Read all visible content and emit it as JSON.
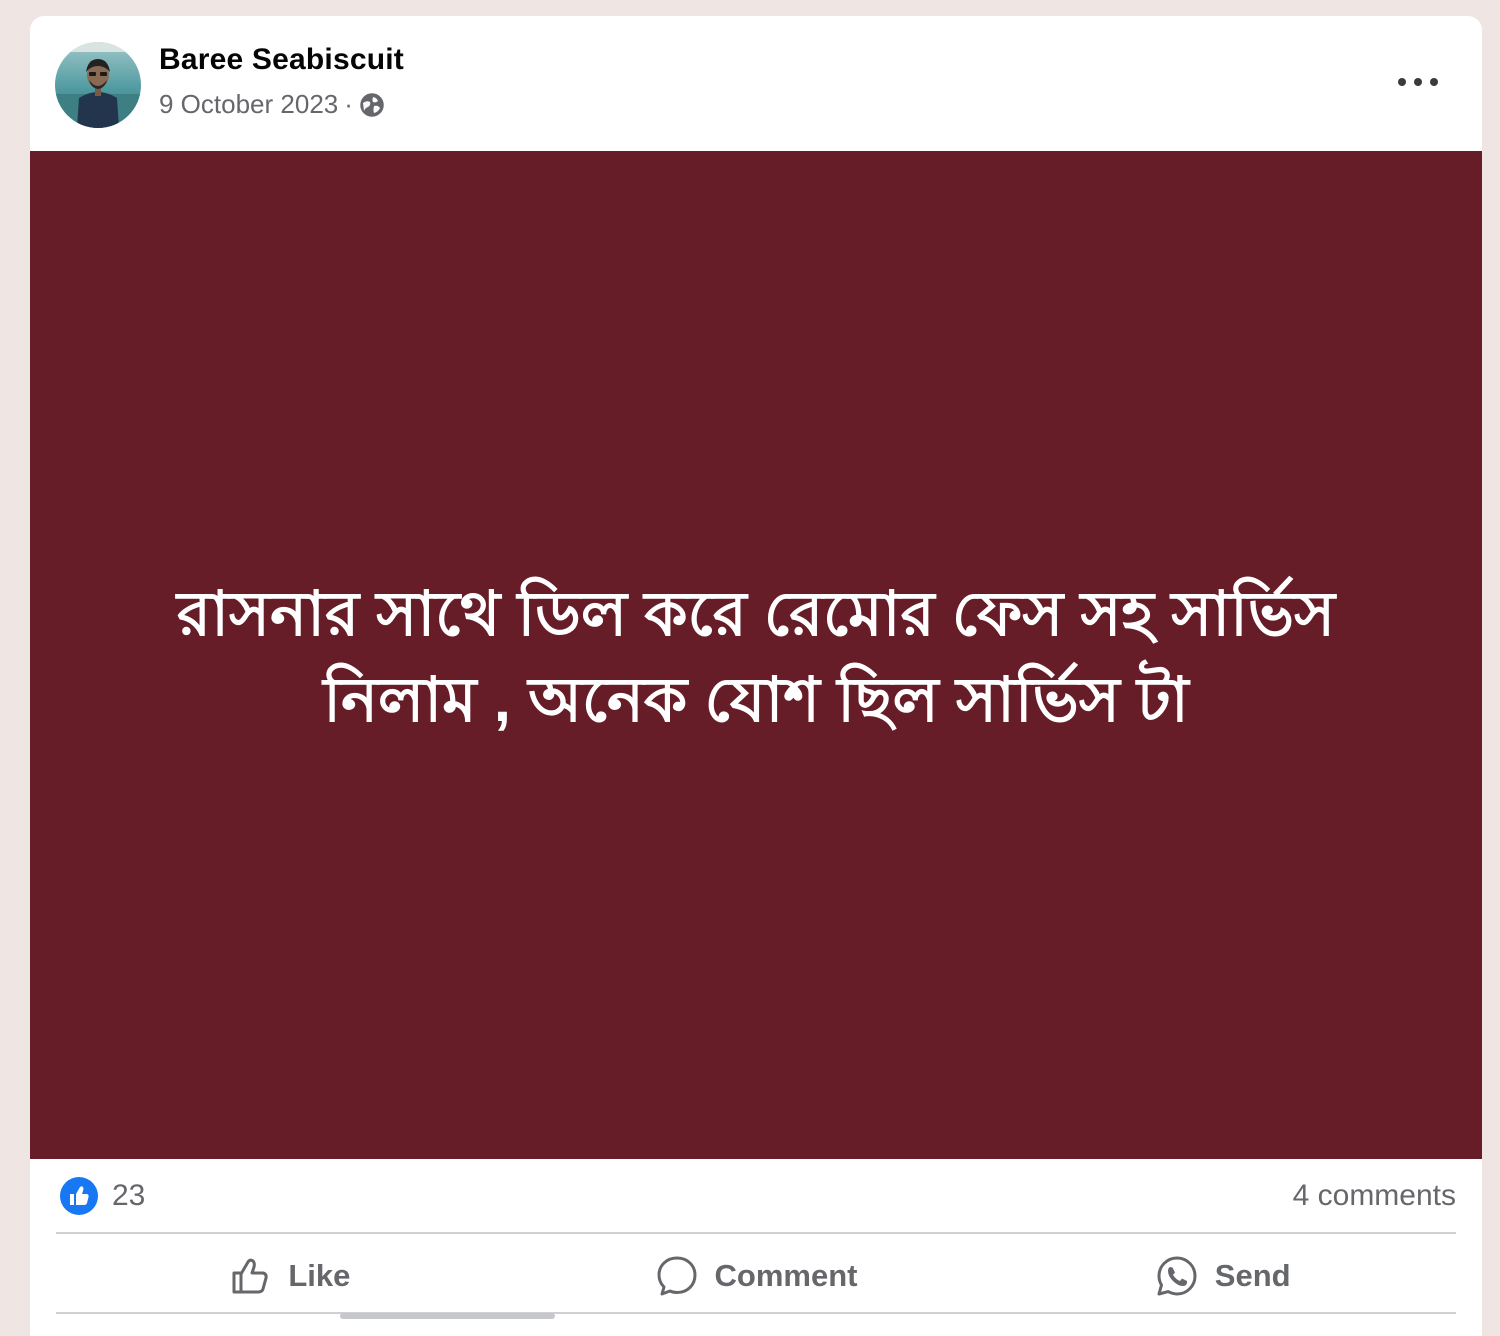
{
  "post": {
    "author": "Baree Seabiscuit",
    "date": "9 October 2023",
    "separator": "·",
    "audience_icon": "globe-icon",
    "more_icon": "more-options-icon",
    "text": "রাসনার সাথে ডিল করে রেমোর ফেস সহ সার্ভিস নিলাম , অনেক যোশ ছিল সার্ভিস টা",
    "background_color": "#661d27",
    "text_color": "#ffffff"
  },
  "stats": {
    "reaction_icon": "like-reaction-icon",
    "reaction_count": "23",
    "comments": "4 comments"
  },
  "actions": {
    "like_label": "Like",
    "comment_label": "Comment",
    "send_label": "Send"
  },
  "colors": {
    "like_blue": "#1877f2",
    "secondary_text": "#65676b",
    "page_bg": "#efe6e3"
  }
}
